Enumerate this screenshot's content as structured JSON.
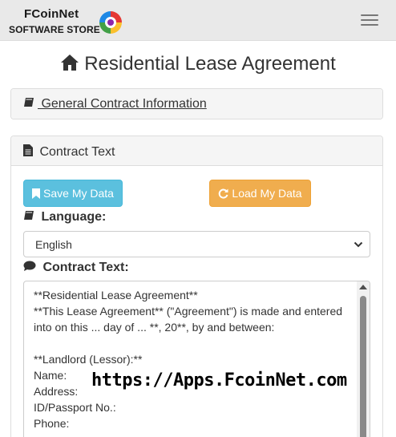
{
  "brand": {
    "line1": "FCoinNet",
    "line2": "SOFTWARE STORE"
  },
  "page": {
    "title": "Residential Lease Agreement",
    "title_icon": "home-icon"
  },
  "panels": {
    "general": {
      "label": " General Contract Information",
      "icon": "book-icon"
    },
    "contract": {
      "label": " Contract Text",
      "icon": "file-text-icon"
    }
  },
  "buttons": {
    "save": {
      "label": " Save My Data",
      "icon": "bookmark-icon",
      "color": "#5bc0de"
    },
    "load": {
      "label": " Load My Data",
      "icon": "refresh-icon",
      "color": "#f0ad4e"
    }
  },
  "language": {
    "label": " Language:",
    "icon": "book-icon",
    "selected": "English"
  },
  "contract_text": {
    "label": " Contract Text:",
    "icon": "comment-icon",
    "value": "**Residential Lease Agreement**\n**This Lease Agreement** (\"Agreement\") is made and entered into on this ... day of ... **, 20**, by and between:\n\n**Landlord (Lessor):**\nName:\nAddress:\nID/Passport No.:\nPhone:"
  },
  "watermark": "https://Apps.FcoinNet.com"
}
